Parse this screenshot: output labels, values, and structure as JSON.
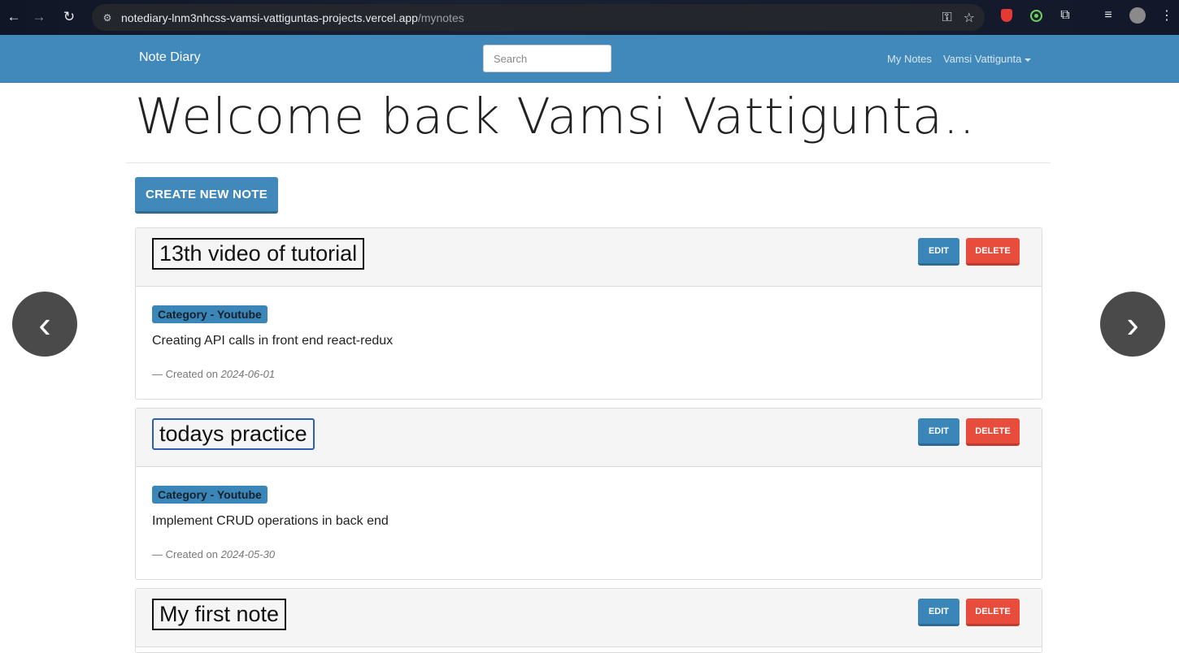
{
  "browser": {
    "url_host": "notediary-lnm3nhcss-vamsi-vattiguntas-projects.vercel.app",
    "url_path": "/mynotes",
    "icons": [
      "back-icon",
      "forward-icon",
      "reload-icon",
      "site-info-icon",
      "key-icon",
      "star-icon",
      "extension-icon",
      "media-icon",
      "profile-icon",
      "menu-icon"
    ]
  },
  "navbar": {
    "brand": "Note Diary",
    "search_placeholder": "Search",
    "my_notes": "My Notes",
    "user": "Vamsi Vattigunta",
    "color": "#4289bb"
  },
  "page": {
    "welcome": "Welcome back Vamsi Vattigunta..",
    "create_button": "CREATE NEW NOTE"
  },
  "notes": [
    {
      "title": "13th video of tutorial",
      "category": "Category - Youtube",
      "content": "Creating API calls in front end react-redux",
      "created_prefix": "— Created on",
      "date": "2024-06-01",
      "edit": "EDIT",
      "delete": "DELETE"
    },
    {
      "title": "todays practice",
      "category": "Category - Youtube",
      "content": "Implement CRUD operations in back end",
      "created_prefix": "— Created on",
      "date": "2024-05-30",
      "edit": "EDIT",
      "delete": "DELETE"
    },
    {
      "title": "My first note",
      "edit": "EDIT",
      "delete": "DELETE"
    }
  ],
  "carousel": {
    "prev": "‹",
    "next": "›"
  },
  "colors": {
    "primary": "#3b86b8",
    "danger": "#e74c3c"
  }
}
